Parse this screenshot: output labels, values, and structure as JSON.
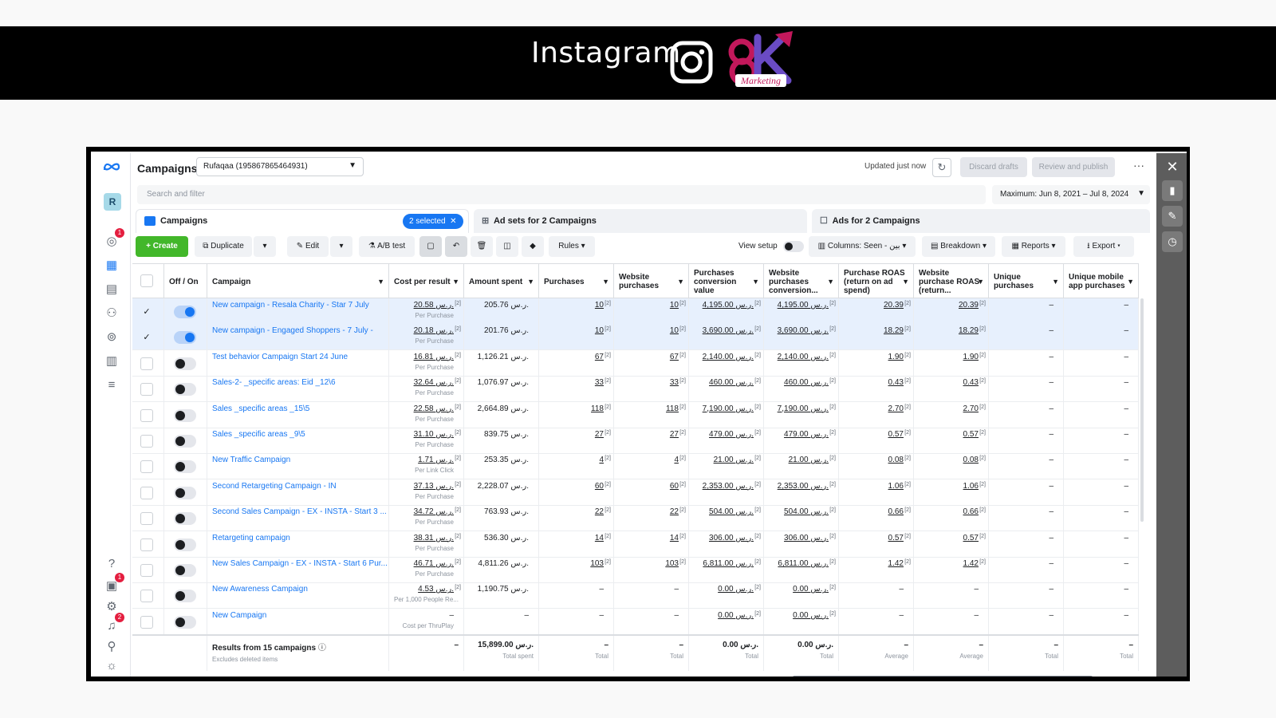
{
  "banner": {
    "title": "Instagram",
    "logo_text": "ok",
    "logo_sub": "Marketing"
  },
  "app": {
    "title": "Campaigns",
    "account": "Rufaqaa (195867865464931)",
    "updated": "Updated just now",
    "discard": "Discard drafts",
    "review": "Review and publish",
    "search_placeholder": "Search and filter",
    "date_range": "Maximum: Jun 8, 2021 – Jul 8, 2024",
    "avatar": "R",
    "badges": {
      "alerts": "1",
      "msgs": "1",
      "notif": "2"
    }
  },
  "tabs": {
    "campaigns": "Campaigns",
    "selected": "2 selected",
    "adsets": "Ad sets for 2 Campaigns",
    "ads": "Ads for 2 Campaigns"
  },
  "toolbar": {
    "create": "Create",
    "duplicate": "Duplicate",
    "edit": "Edit",
    "abtest": "A/B test",
    "rules": "Rules",
    "view_setup": "View setup",
    "columns": "Columns: Seen - بين",
    "breakdown": "Breakdown",
    "reports": "Reports",
    "export": "Export"
  },
  "columns": [
    "Off / On",
    "Campaign",
    "Cost per result",
    "Amount spent",
    "Purchases",
    "Website purchases",
    "Purchases conversion value",
    "Website purchases conversion...",
    "Purchase ROAS (return on ad spend)",
    "Website purchase ROAS (return...",
    "Unique purchases",
    "Unique mobile app purchases"
  ],
  "rows": [
    {
      "sel": true,
      "on": true,
      "name": "New campaign - Resala Charity - Star 7 July",
      "cpr": "20.58 ر.س.",
      "cpr_sub": "Per Purchase",
      "spent": "205.76 ر.س.",
      "purch": "10",
      "wpurch": "10",
      "pcv": "4,195.00 ر.س.",
      "wpcv": "4,195.00 ر.س.",
      "roas": "20.39",
      "wroas": "20.39",
      "uniq": "–",
      "umob": "–"
    },
    {
      "sel": true,
      "on": true,
      "name": "New campaign - Engaged Shoppers - 7 July -",
      "cpr": "20.18 ر.س.",
      "cpr_sub": "Per Purchase",
      "spent": "201.76 ر.س.",
      "purch": "10",
      "wpurch": "10",
      "pcv": "3,690.00 ر.س.",
      "wpcv": "3,690.00 ر.س.",
      "roas": "18.29",
      "wroas": "18.29",
      "uniq": "–",
      "umob": "–"
    },
    {
      "sel": false,
      "on": false,
      "name": "Test behavior Campaign Start 24 June",
      "cpr": "16.81 ر.س.",
      "cpr_sub": "Per Purchase",
      "spent": "1,126.21 ر.س.",
      "purch": "67",
      "wpurch": "67",
      "pcv": "2,140.00 ر.س.",
      "wpcv": "2,140.00 ر.س.",
      "roas": "1.90",
      "wroas": "1.90",
      "uniq": "–",
      "umob": "–"
    },
    {
      "sel": false,
      "on": false,
      "name": "Sales-2- _specific areas: Eid _12\\6",
      "cpr": "32.64 ر.س.",
      "cpr_sub": "Per Purchase",
      "spent": "1,076.97 ر.س.",
      "purch": "33",
      "wpurch": "33",
      "pcv": "460.00 ر.س.",
      "wpcv": "460.00 ر.س.",
      "roas": "0.43",
      "wroas": "0.43",
      "uniq": "–",
      "umob": "–"
    },
    {
      "sel": false,
      "on": false,
      "name": "Sales _specific areas _15\\5",
      "cpr": "22.58 ر.س.",
      "cpr_sub": "Per Purchase",
      "spent": "2,664.89 ر.س.",
      "purch": "118",
      "wpurch": "118",
      "pcv": "7,190.00 ر.س.",
      "wpcv": "7,190.00 ر.س.",
      "roas": "2.70",
      "wroas": "2.70",
      "uniq": "–",
      "umob": "–"
    },
    {
      "sel": false,
      "on": false,
      "name": "Sales _specific areas _9\\5",
      "cpr": "31.10 ر.س.",
      "cpr_sub": "Per Purchase",
      "spent": "839.75 ر.س.",
      "purch": "27",
      "wpurch": "27",
      "pcv": "479.00 ر.س.",
      "wpcv": "479.00 ر.س.",
      "roas": "0.57",
      "wroas": "0.57",
      "uniq": "–",
      "umob": "–"
    },
    {
      "sel": false,
      "on": false,
      "name": "New Traffic Campaign",
      "cpr": "1.71 ر.س.",
      "cpr_sub": "Per Link Click",
      "spent": "253.35 ر.س.",
      "purch": "4",
      "wpurch": "4",
      "pcv": "21.00 ر.س.",
      "wpcv": "21.00 ر.س.",
      "roas": "0.08",
      "wroas": "0.08",
      "uniq": "–",
      "umob": "–"
    },
    {
      "sel": false,
      "on": false,
      "name": "Second Retargeting Campaign - IN",
      "cpr": "37.13 ر.س.",
      "cpr_sub": "Per Purchase",
      "spent": "2,228.07 ر.س.",
      "purch": "60",
      "wpurch": "60",
      "pcv": "2,353.00 ر.س.",
      "wpcv": "2,353.00 ر.س.",
      "roas": "1.06",
      "wroas": "1.06",
      "uniq": "–",
      "umob": "–"
    },
    {
      "sel": false,
      "on": false,
      "name": "Second Sales Campaign - EX - INSTA - Start 3 ...",
      "cpr": "34.72 ر.س.",
      "cpr_sub": "Per Purchase",
      "spent": "763.93 ر.س.",
      "purch": "22",
      "wpurch": "22",
      "pcv": "504.00 ر.س.",
      "wpcv": "504.00 ر.س.",
      "roas": "0.66",
      "wroas": "0.66",
      "uniq": "–",
      "umob": "–"
    },
    {
      "sel": false,
      "on": false,
      "name": "Retargeting campaign",
      "cpr": "38.31 ر.س.",
      "cpr_sub": "Per Purchase",
      "spent": "536.30 ر.س.",
      "purch": "14",
      "wpurch": "14",
      "pcv": "306.00 ر.س.",
      "wpcv": "306.00 ر.س.",
      "roas": "0.57",
      "wroas": "0.57",
      "uniq": "–",
      "umob": "–"
    },
    {
      "sel": false,
      "on": false,
      "name": "New Sales Campaign - EX - INSTA - Start 6 Pur...",
      "cpr": "46.71 ر.س.",
      "cpr_sub": "Per Purchase",
      "spent": "4,811.26 ر.س.",
      "purch": "103",
      "wpurch": "103",
      "pcv": "6,811.00 ر.س.",
      "wpcv": "6,811.00 ر.س.",
      "roas": "1.42",
      "wroas": "1.42",
      "uniq": "–",
      "umob": "–"
    },
    {
      "sel": false,
      "on": false,
      "name": "New Awareness Campaign",
      "cpr": "4.53 ر.س.",
      "cpr_sub": "Per 1,000 People Re...",
      "spent": "1,190.75 ر.س.",
      "purch": "–",
      "wpurch": "–",
      "pcv": "0.00 ر.س.",
      "wpcv": "0.00 ر.س.",
      "roas": "–",
      "wroas": "–",
      "uniq": "–",
      "umob": "–"
    },
    {
      "sel": false,
      "on": false,
      "name": "New Campaign",
      "cpr": "–",
      "cpr_sub": "Cost per ThruPlay",
      "spent": "–",
      "purch": "–",
      "wpurch": "–",
      "pcv": "0.00 ر.س.",
      "wpcv": "0.00 ر.س.",
      "roas": "–",
      "wroas": "–",
      "uniq": "–",
      "umob": "–"
    }
  ],
  "footer": {
    "label": "Results from 15 campaigns",
    "sub": "Excludes deleted items",
    "cpr": "–",
    "spent": "15,899.00 ر.س.",
    "spent_sub": "Total spent",
    "purch": "–",
    "purch_sub": "Total",
    "wpurch": "–",
    "wpurch_sub": "Total",
    "pcv": "0.00 ر.س.",
    "pcv_sub": "Total",
    "wpcv": "0.00 ر.س.",
    "wpcv_sub": "Total",
    "roas": "–",
    "roas_sub": "Average",
    "wroas": "–",
    "wroas_sub": "Average",
    "uniq": "–",
    "uniq_sub": "Total",
    "umob": "–",
    "umob_sub": "Total"
  }
}
